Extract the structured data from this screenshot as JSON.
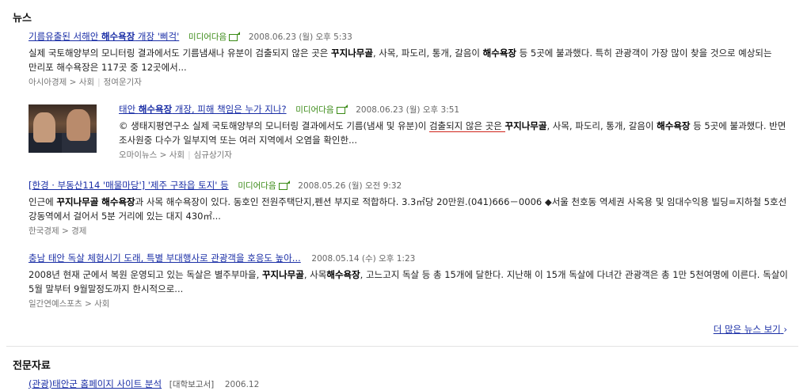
{
  "news": {
    "section_title": "뉴스",
    "items": [
      {
        "headline_pre": "기름유출된 서해안 ",
        "headline_bold": "해수욕장",
        "headline_post": " 개장 '삐걱'",
        "media": "미디어다음",
        "date": "2008.06.23 (월) 오후 5:33",
        "snippet_1": "실제 국토해양부의 모니터링 결과에서도 기름냄새나 유분이 검출되지 않은 곳은 ",
        "snippet_b1": "꾸지나무골",
        "snippet_2": ", 사목, 파도리, 통개, 갈음이 ",
        "snippet_b2": "해수욕장",
        "snippet_3": " 등 5곳에 불과했다. 특히 관광객이 가장 많이 찾을 것으로 예상되는 만리포 해수욕장은 117곳 중 12곳에서...",
        "source": "아시아경제 > 사회",
        "reporter": "정여운기자"
      },
      {
        "headline_pre": "태안 ",
        "headline_bold": "해수욕장",
        "headline_post": " 개장, 피해 책임은 누가 지나?",
        "media": "미디어다음",
        "date": "2008.06.23 (월) 오후 3:51",
        "snippet_1": "© 생태지평연구소 실제 국토해양부의 모니터링 결과에서도 기름(냄새 및 유분)이 ",
        "snippet_u": "검출되지 않은 곳은 ",
        "snippet_b1": "꾸지나무골",
        "snippet_2": ", 사목, 파도리, 통개, 갈음이 ",
        "snippet_b2": "해수욕장",
        "snippet_3": " 등 5곳에 불과했다. 반면 조사원중 다수가 일부지역 또는 여러 지역에서 오염을 확인한...",
        "source": "오마이뉴스 > 사회",
        "reporter": "심규상기자"
      },
      {
        "headline_pre": "[한경 · 부동산114 '매물마당'] '제주 구좌읍 토지' 등",
        "headline_bold": "",
        "headline_post": "",
        "media": "미디어다음",
        "date": "2008.05.26 (월) 오전 9:32",
        "snippet_1": "인근에 ",
        "snippet_b1": "꾸지나무골 해수욕장",
        "snippet_2": "과 사목 해수욕장이 있다. 동호인 전원주택단지,펜션 부지로 적합하다. 3.3㎡당 20만원.(041)666－0006 ◆서울 천호동 역세권 사옥용 및 임대수익용 빌딩=지하철 5호선 강동역에서 걸어서 5분 거리에 있는 대지 430㎡...",
        "source": "한국경제 > 경제",
        "reporter": ""
      },
      {
        "headline_pre": "충남 태안 독살 체험시기 도래, 특별 부대행사로 관광객을 호응도 높아...",
        "headline_bold": "",
        "headline_post": "",
        "media": "",
        "date": "2008.05.14 (수) 오후 1:23",
        "snippet_1": "2008년 현재 군에서 복원 운영되고 있는 독살은 별주부마을, ",
        "snippet_b1": "꾸지나무골",
        "snippet_2": ", 사목",
        "snippet_b2": "해수욕장",
        "snippet_3": ", 고느고지 독살 등 총 15개에 달한다. 지난해 이 15개 독살에 다녀간 관광객은 총 1만 5천여명에 이른다. 독살이 5월 말부터 9월말정도까지 한시적으로...",
        "source": "일간연예스포츠 > 사회",
        "reporter": ""
      }
    ],
    "more_label": "더 많은 뉴스 보기"
  },
  "expert": {
    "section_title": "전문자료",
    "item_title": "(관광)태안군 홈페이지 사이트 분석",
    "item_tag": "[대학보고서]",
    "item_date": "2006.12"
  },
  "colors": {
    "link": "#1a2ea6",
    "media": "#3a8a16",
    "underline": "#d0251c"
  },
  "icons": [
    "external-link-icon",
    "chevron-right-icon"
  ]
}
